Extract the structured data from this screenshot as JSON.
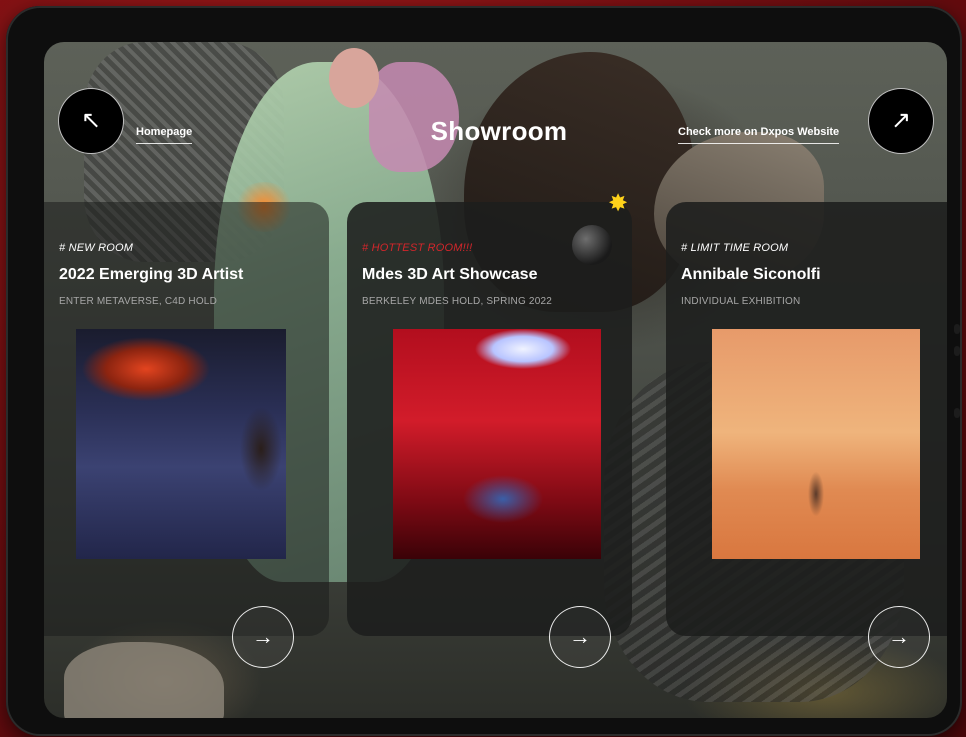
{
  "header": {
    "title": "Showroom",
    "home_link": "Homepage",
    "dxpos_link": "Check more on Dxpos Website",
    "back_icon": "↖",
    "external_icon": "↗"
  },
  "cards": [
    {
      "tag": "# NEW ROOM",
      "title": "2022 Emerging 3D Artist",
      "subtitle": "ENTER METAVERSE, C4D HOLD",
      "arrow_icon": "→"
    },
    {
      "tag": "# HOTTEST ROOM!!!",
      "title": "Mdes 3D Art Showcase",
      "subtitle": "BERKELEY MDES HOLD, SPRING 2022",
      "arrow_icon": "→"
    },
    {
      "tag": "# LIMIT TIME ROOM",
      "title": "Annibale Siconolfi",
      "subtitle": "INDIVIDUAL EXHIBITION",
      "arrow_icon": "→"
    }
  ],
  "colors": {
    "hot_tag": "#d3262b",
    "background": "#7a0f12"
  },
  "icons": {
    "bomb": "bomb-emoji",
    "spark": "✸"
  }
}
